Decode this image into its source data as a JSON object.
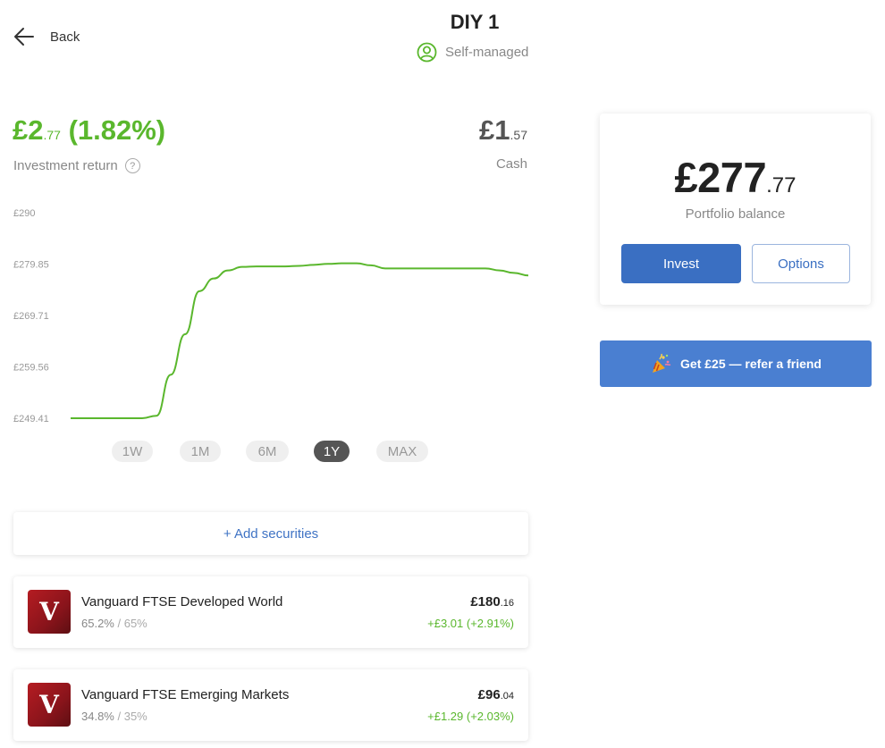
{
  "header": {
    "back_label": "Back",
    "title": "DIY 1",
    "subtitle": "Self-managed"
  },
  "summary": {
    "return_main": "£2",
    "return_pence": ".77",
    "return_pct": "(1.82%)",
    "return_label": "Investment return",
    "help_glyph": "?",
    "cash_main": "£1",
    "cash_pence": ".57",
    "cash_label": "Cash"
  },
  "chart_data": {
    "type": "line",
    "y_ticks": [
      "£290",
      "£279.85",
      "£269.71",
      "£259.56",
      "£249.41"
    ],
    "ylim": [
      249.41,
      290
    ],
    "series": [
      {
        "values": [
          249.41,
          249.41,
          249.41,
          249.41,
          249.41,
          249.41,
          249.9,
          258.0,
          266.0,
          274.5,
          277.0,
          278.6,
          279.3,
          279.4,
          279.4,
          279.4,
          279.5,
          279.7,
          279.9,
          280.0,
          280.0,
          279.6,
          279.0,
          279.0,
          279.0,
          279.0,
          279.0,
          279.0,
          279.0,
          279.0,
          278.6,
          278.1,
          277.6
        ]
      }
    ],
    "color": "#5ab72d",
    "grid": false
  },
  "ranges": [
    {
      "label": "1W",
      "active": false
    },
    {
      "label": "1M",
      "active": false
    },
    {
      "label": "6M",
      "active": false
    },
    {
      "label": "1Y",
      "active": true
    },
    {
      "label": "MAX",
      "active": false
    }
  ],
  "add_securities": "+ Add securities",
  "holdings": [
    {
      "logo": "V",
      "name": "Vanguard FTSE Developed World",
      "alloc": "65.2%",
      "target": " / 65%",
      "value_main": "£180",
      "value_pence": ".16",
      "change": "+£3.01 (+2.91%)"
    },
    {
      "logo": "V",
      "name": "Vanguard FTSE Emerging Markets",
      "alloc": "34.8%",
      "target": " / 35%",
      "value_main": "£96",
      "value_pence": ".04",
      "change": "+£1.29 (+2.03%)"
    }
  ],
  "portfolio": {
    "balance_main": "£277",
    "balance_pence": ".77",
    "balance_label": "Portfolio balance",
    "invest_label": "Invest",
    "options_label": "Options"
  },
  "referral": {
    "label": "Get £25 — refer a friend",
    "icon": "party-popper-icon"
  },
  "colors": {
    "accent_green": "#5ab72d",
    "primary_blue": "#3a6fc2",
    "referral_blue": "#4a7fd1"
  }
}
